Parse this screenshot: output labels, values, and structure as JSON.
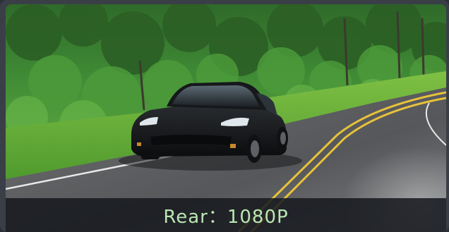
{
  "camera_preview": {
    "image_subject": "car-on-road-photo",
    "caption": "Rear：1080P",
    "caption_color": "#b9e6b1",
    "bar_color": "#16181e"
  }
}
